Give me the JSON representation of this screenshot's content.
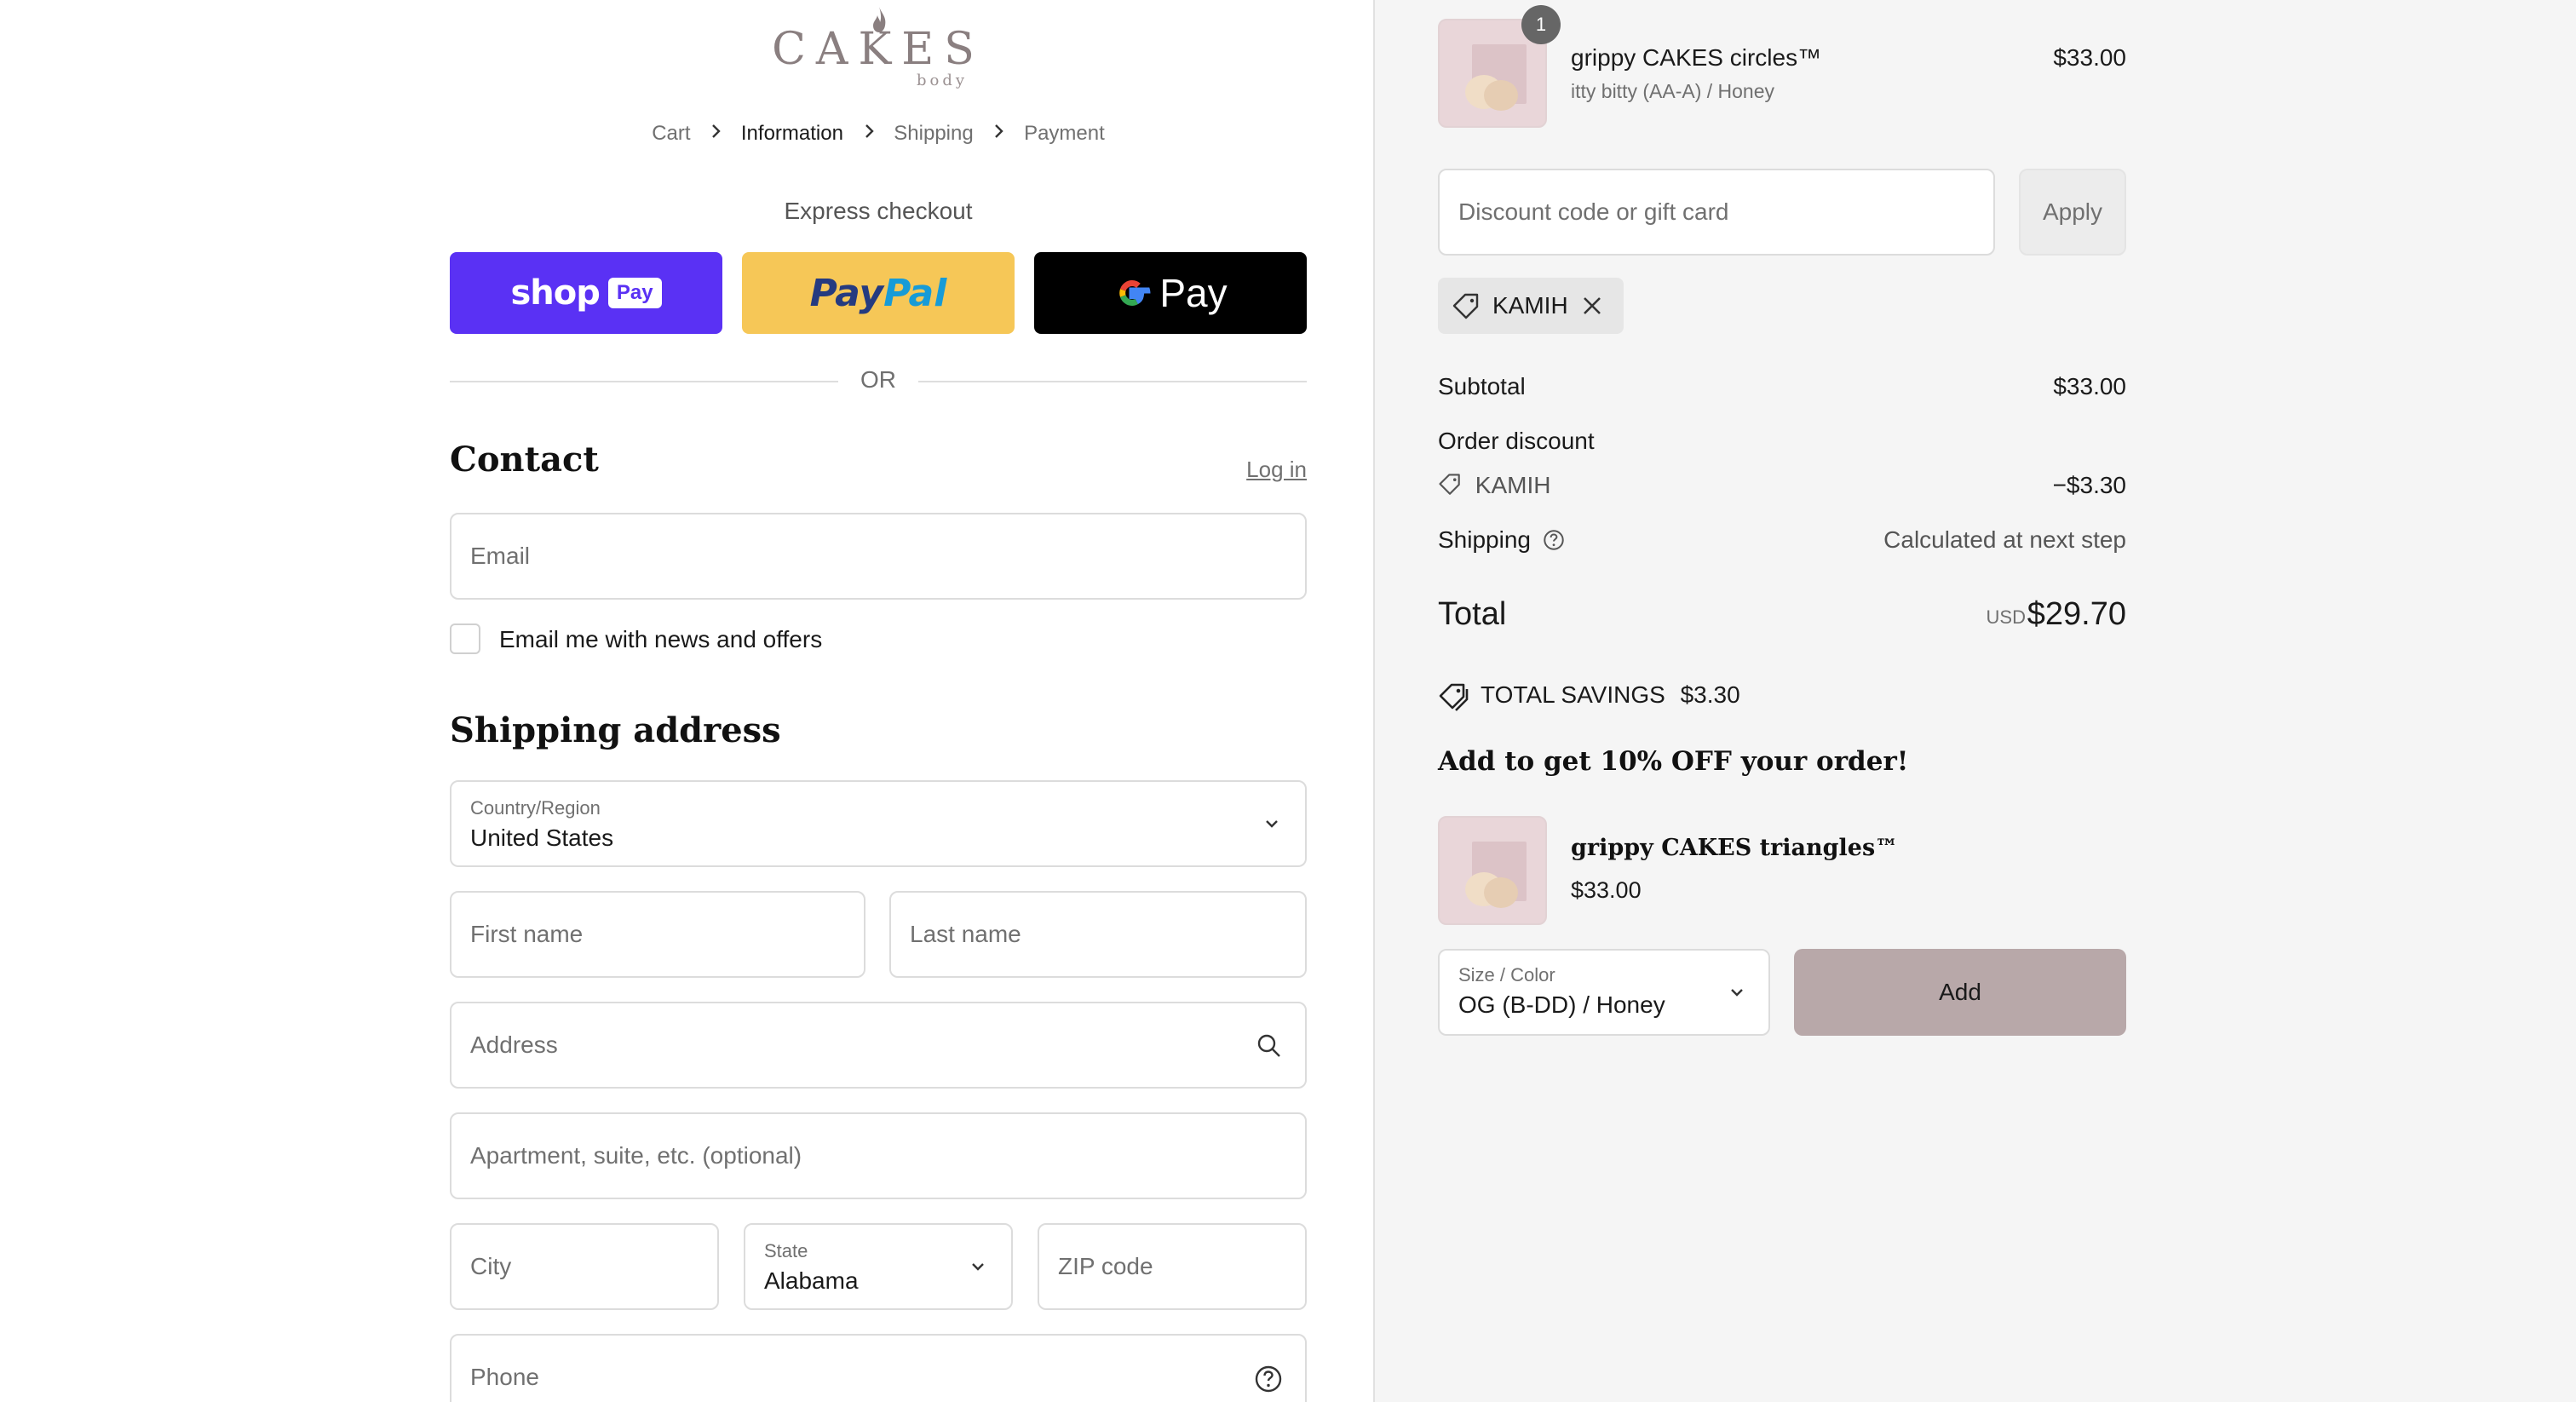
{
  "brand": {
    "word": "CAKES",
    "sub": "body"
  },
  "breadcrumb": [
    {
      "label": "Cart"
    },
    {
      "label": "Information"
    },
    {
      "label": "Shipping"
    },
    {
      "label": "Payment"
    }
  ],
  "express": {
    "title": "Express checkout",
    "shop_pay": {
      "word": "shop",
      "badge": "Pay"
    },
    "paypal": {
      "part1": "Pay",
      "part2": "Pal"
    },
    "gpay": {
      "word": "Pay"
    },
    "or": "OR"
  },
  "contact": {
    "title": "Contact",
    "login": "Log in",
    "email_placeholder": "Email",
    "news_label": "Email me with news and offers"
  },
  "shipping": {
    "title": "Shipping address",
    "country_label": "Country/Region",
    "country_value": "United States",
    "first_name": "First name",
    "last_name": "Last name",
    "address": "Address",
    "apartment": "Apartment, suite, etc. (optional)",
    "city": "City",
    "state_label": "State",
    "state_value": "Alabama",
    "zip": "ZIP code",
    "phone": "Phone"
  },
  "summary": {
    "item": {
      "quantity": "1",
      "name": "grippy CAKES circles™",
      "variant": "itty bitty (AA-A) / Honey",
      "price": "$33.00"
    },
    "discount_placeholder": "Discount code or gift card",
    "apply": "Apply",
    "applied_code": "KAMIH",
    "subtotal_label": "Subtotal",
    "subtotal": "$33.00",
    "order_discount_label": "Order discount",
    "discount_code": "KAMIH",
    "discount_amount": "−$3.30",
    "shipping_label": "Shipping",
    "shipping_value": "Calculated at next step",
    "total_label": "Total",
    "currency": "USD",
    "total": "$29.70",
    "savings_label": "TOTAL SAVINGS",
    "savings_amount": "$3.30"
  },
  "upsell": {
    "title": "Add to get 10% OFF your order!",
    "name": "grippy CAKES triangles™",
    "price": "$33.00",
    "select_label": "Size / Color",
    "select_value": "OG (B-DD) / Honey",
    "add": "Add"
  },
  "colors": {
    "shop_pay": "#5a31f4",
    "paypal": "#f6c757",
    "gpay": "#000000",
    "add_button": "#b8a8a9",
    "summary_bg": "#f5f5f5"
  }
}
